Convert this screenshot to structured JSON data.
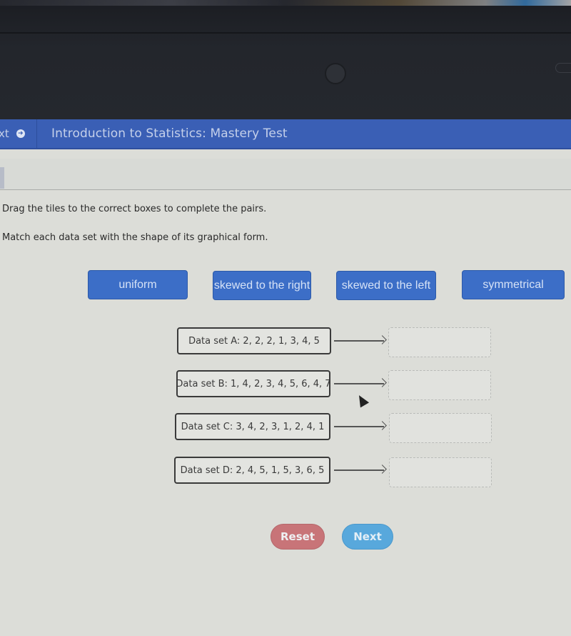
{
  "header": {
    "back_label": "xt",
    "back_icon": "arrow-right-circle-icon",
    "title": "Introduction to Statistics: Mastery Test"
  },
  "instructions": {
    "line1": "Drag the tiles to the correct boxes to complete the pairs.",
    "line2": "Match each data set with the shape of its graphical form."
  },
  "tiles": [
    {
      "label": "uniform"
    },
    {
      "label": "skewed to the right"
    },
    {
      "label": "skewed to the left"
    },
    {
      "label": "symmetrical"
    }
  ],
  "pairs": [
    {
      "label": "Data set A: 2, 2, 2, 1, 3, 4, 5",
      "target": ""
    },
    {
      "label": "Data set B: 1, 4, 2, 3, 4, 5, 6, 4, 7",
      "target": ""
    },
    {
      "label": "Data set C: 3, 4, 2, 3, 1, 2, 4, 1",
      "target": ""
    },
    {
      "label": "Data set D: 2, 4, 5, 1, 5, 3, 6, 5",
      "target": ""
    }
  ],
  "buttons": {
    "reset": "Reset",
    "next": "Next"
  },
  "colors": {
    "header_bg": "#3a5fb5",
    "tile_bg": "#3c6ec7",
    "reset_bg": "#c87478",
    "next_bg": "#58a8dc"
  }
}
